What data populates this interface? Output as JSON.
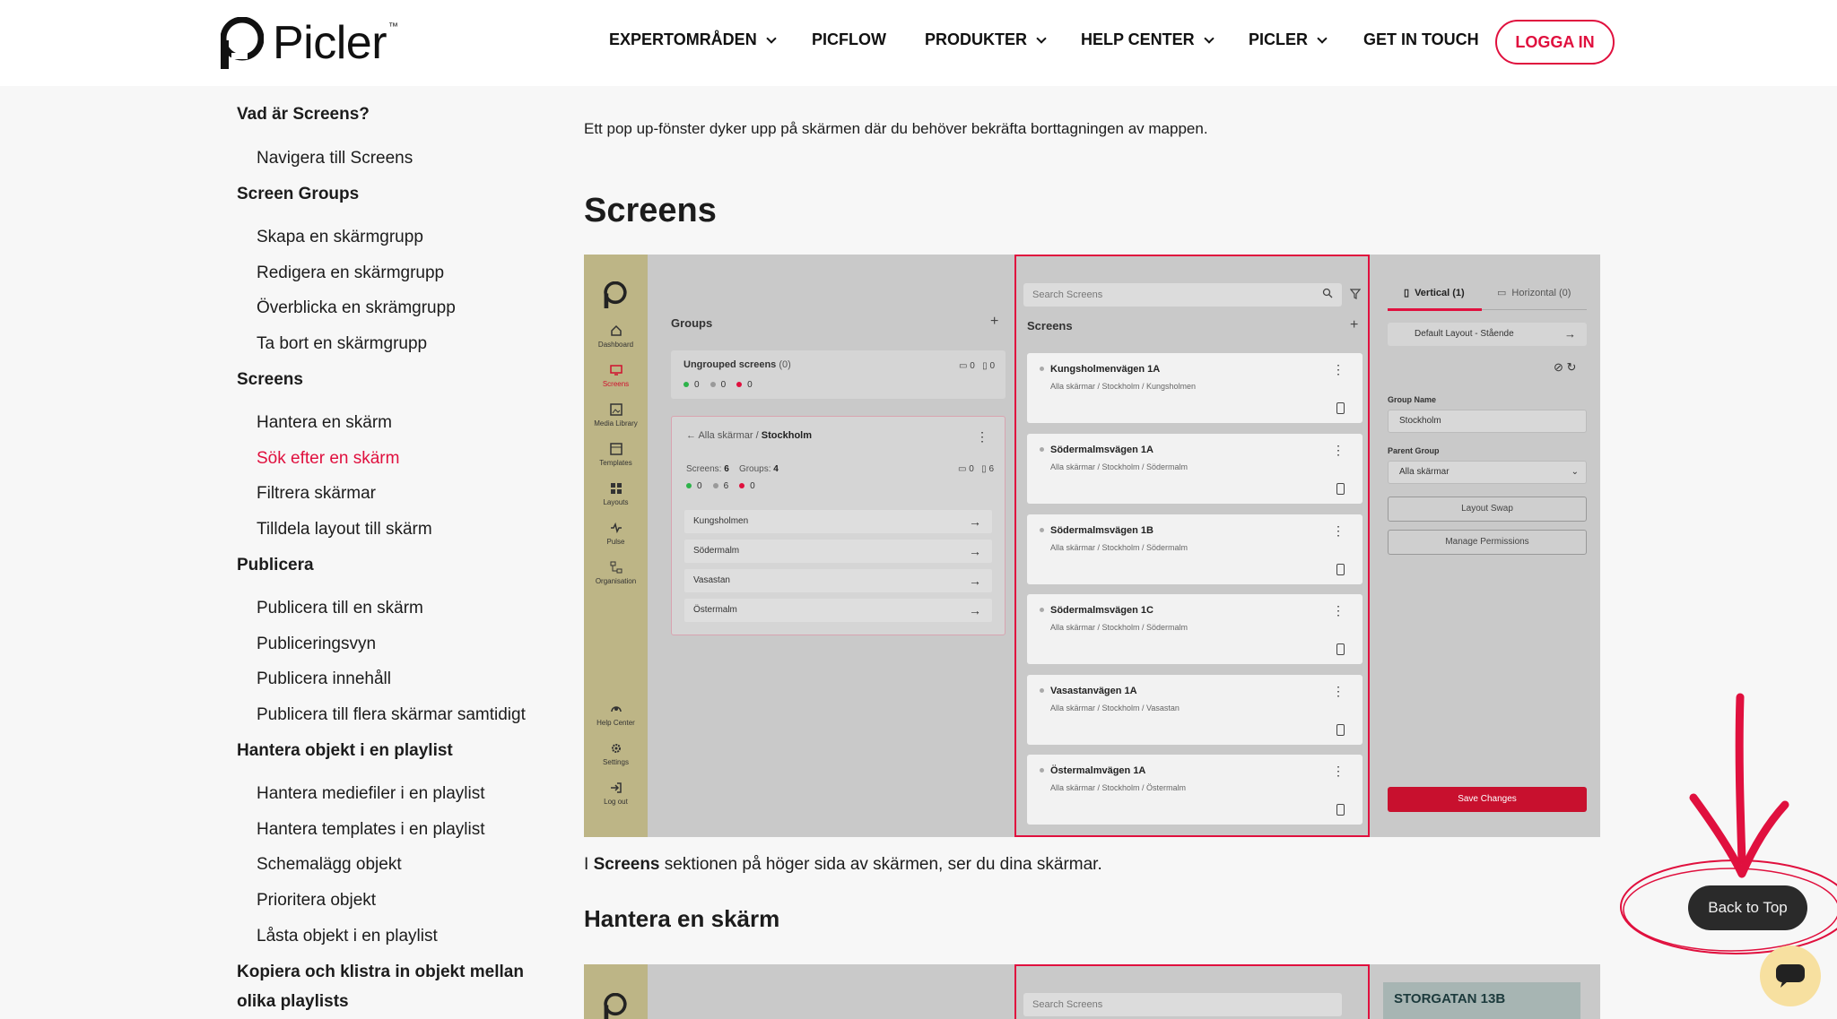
{
  "header": {
    "logo_text": "Picler",
    "logo_tm": "™",
    "nav": [
      {
        "label": "EXPERTOMRÅDEN",
        "dropdown": true
      },
      {
        "label": "PICFLOW",
        "dropdown": false
      },
      {
        "label": "PRODUKTER",
        "dropdown": true
      },
      {
        "label": "HELP CENTER",
        "dropdown": true
      },
      {
        "label": "PICLER",
        "dropdown": true
      },
      {
        "label": "GET IN TOUCH",
        "dropdown": false
      }
    ],
    "login_label": "LOGGA IN"
  },
  "toc": [
    {
      "label": "Vad är Screens?",
      "type": "heading"
    },
    {
      "label": "Navigera till Screens",
      "type": "sub"
    },
    {
      "label": "Screen Groups",
      "type": "heading"
    },
    {
      "label": "Skapa en skärmgrupp",
      "type": "sub"
    },
    {
      "label": "Redigera en skärmgrupp",
      "type": "sub"
    },
    {
      "label": "Överblicka en skrämgrupp",
      "type": "sub"
    },
    {
      "label": "Ta bort en skärmgrupp",
      "type": "sub"
    },
    {
      "label": "Screens",
      "type": "heading"
    },
    {
      "label": "Hantera en skärm",
      "type": "sub"
    },
    {
      "label": "Sök efter en skärm",
      "type": "sub",
      "active": true
    },
    {
      "label": "Filtrera skärmar",
      "type": "sub"
    },
    {
      "label": "Tilldela layout till skärm",
      "type": "sub"
    },
    {
      "label": "Publicera",
      "type": "heading"
    },
    {
      "label": "Publicera till en skärm",
      "type": "sub"
    },
    {
      "label": "Publiceringsvyn",
      "type": "sub"
    },
    {
      "label": "Publicera innehåll",
      "type": "sub"
    },
    {
      "label": "Publicera till flera skärmar samtidigt",
      "type": "sub"
    },
    {
      "label": "Hantera objekt i en playlist",
      "type": "heading"
    },
    {
      "label": "Hantera mediefiler i en playlist",
      "type": "sub"
    },
    {
      "label": "Hantera templates i en playlist",
      "type": "sub"
    },
    {
      "label": "Schemalägg objekt",
      "type": "sub"
    },
    {
      "label": "Prioritera objekt",
      "type": "sub"
    },
    {
      "label": "Låsta objekt i en playlist",
      "type": "sub"
    },
    {
      "label": "Kopiera och klistra in objekt mellan",
      "type": "heading"
    },
    {
      "label": "olika playlists",
      "type": "heading"
    }
  ],
  "main": {
    "intro": "Ett pop up-fönster dyker upp på skärmen där du behöver bekräfta borttagningen av mappen.",
    "section_title": "Screens",
    "caption_prefix": "I ",
    "caption_bold": "Screens",
    "caption_suffix": " sektionen på höger sida av skärmen, ser du dina skärmar.",
    "subsection_title": "Hantera en skärm"
  },
  "app": {
    "sidebar": [
      {
        "label": "Dashboard",
        "icon": "home-icon"
      },
      {
        "label": "Screens",
        "icon": "monitor-icon",
        "active": true
      },
      {
        "label": "Media Library",
        "icon": "image-icon"
      },
      {
        "label": "Templates",
        "icon": "template-icon"
      },
      {
        "label": "Layouts",
        "icon": "grid-icon"
      },
      {
        "label": "Pulse",
        "icon": "pulse-icon"
      },
      {
        "label": "Organisation",
        "icon": "org-icon"
      },
      {
        "label": "Help Center",
        "icon": "help-icon"
      },
      {
        "label": "Settings",
        "icon": "gear-icon"
      },
      {
        "label": "Log out",
        "icon": "logout-icon"
      }
    ],
    "groups": {
      "title": "Groups",
      "ungrouped_title": "Ungrouped screens",
      "ungrouped_count": "(0)",
      "ungrouped_dots": [
        "0",
        "0",
        "0"
      ],
      "ungrouped_landscape": "0",
      "ungrouped_portrait": "0",
      "breadcrumb_prefix": "Alla skärmar /",
      "breadcrumb_current": "Stockholm",
      "screens_label": "Screens:",
      "screens_count": "6",
      "groups_label": "Groups:",
      "groups_count": "4",
      "stockholm_dots": [
        "0",
        "6",
        "0"
      ],
      "stockholm_landscape": "0",
      "stockholm_portrait": "6",
      "subgroups": [
        "Kungsholmen",
        "Södermalm",
        "Vasastan",
        "Östermalm"
      ]
    },
    "screens": {
      "search_placeholder": "Search Screens",
      "title": "Screens",
      "items": [
        {
          "name": "Kungsholmenvägen 1A",
          "path": "Alla skärmar / Stockholm / Kungsholmen"
        },
        {
          "name": "Södermalmsvägen 1A",
          "path": "Alla skärmar / Stockholm / Södermalm"
        },
        {
          "name": "Södermalmsvägen 1B",
          "path": "Alla skärmar / Stockholm / Södermalm"
        },
        {
          "name": "Södermalmsvägen 1C",
          "path": "Alla skärmar / Stockholm / Södermalm"
        },
        {
          "name": "Vasastanvägen 1A",
          "path": "Alla skärmar / Stockholm / Vasastan"
        },
        {
          "name": "Östermalmvägen 1A",
          "path": "Alla skärmar / Stockholm / Östermalm"
        }
      ]
    },
    "details": {
      "tab_vertical": "Vertical (1)",
      "tab_horizontal": "Horizontal (0)",
      "layout": "Default Layout - Stående",
      "group_name_label": "Group Name",
      "group_name_value": "Stockholm",
      "parent_group_label": "Parent Group",
      "parent_group_value": "Alla skärmar",
      "layout_swap": "Layout Swap",
      "manage_permissions": "Manage Permissions",
      "save_changes": "Save Changes"
    }
  },
  "shot2": {
    "search_placeholder": "Search Screens",
    "store_name": "STORGATAN 13B"
  },
  "back_to_top": "Back to Top",
  "colors": {
    "brand_red": "#e0103e",
    "app_sidebar": "#bdb586"
  }
}
